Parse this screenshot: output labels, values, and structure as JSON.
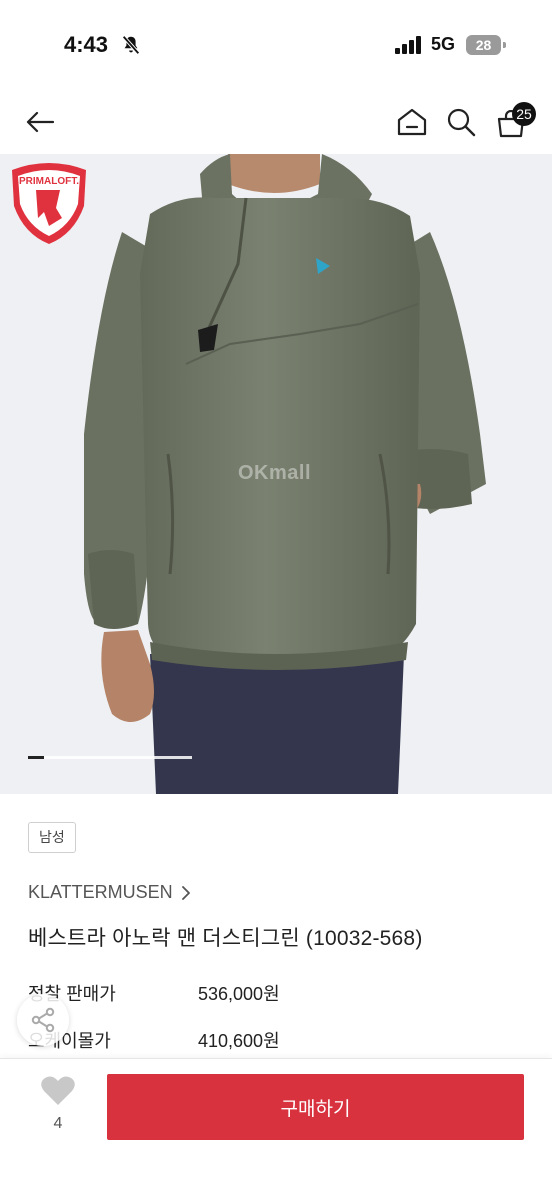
{
  "status_bar": {
    "time": "4:43",
    "network": "5G",
    "battery": "28"
  },
  "header": {
    "cart_count": "25"
  },
  "hero": {
    "badge_text": "PRIMALOFT.",
    "watermark": "OKmall",
    "image_count_position": 1
  },
  "product": {
    "gender_tag": "남성",
    "brand": "KLATTERMUSEN",
    "title": "베스트라 아노락 맨 더스티그린 (10032-568)",
    "prices": {
      "regular_label": "정찰 판매가",
      "regular_value": "536,000원",
      "okmall_label": "오케이몰가",
      "okmall_value": "410,600원"
    }
  },
  "bottom_bar": {
    "like_count": "4",
    "buy_label": "구매하기"
  },
  "colors": {
    "buy_button": "#d8323f",
    "jacket": "#737a68",
    "pants": "#34364e",
    "badge_red": "#e0323e"
  },
  "icons": [
    "back-arrow-icon",
    "home-icon",
    "search-icon",
    "cart-icon",
    "share-icon",
    "heart-icon",
    "mute-bell-icon",
    "signal-icon",
    "battery-icon"
  ]
}
